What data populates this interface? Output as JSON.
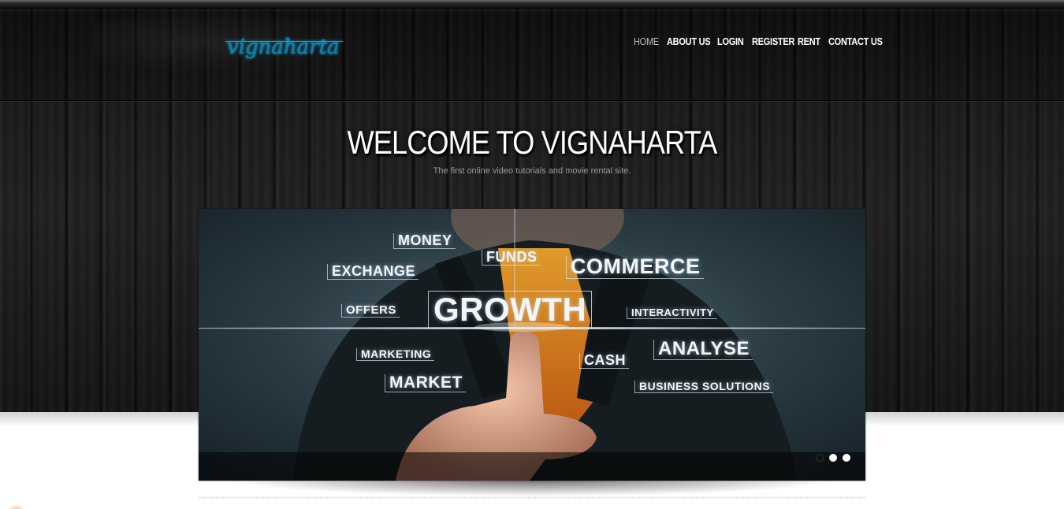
{
  "site": {
    "logo_text": "vignaharta",
    "colors": {
      "logo": "#0a7ea8",
      "nav_active": "#bdbdbd",
      "nav": "#ffffff",
      "background": "#1a1a1a"
    }
  },
  "nav": {
    "items": [
      {
        "label": "HOME",
        "active": true
      },
      {
        "label": "ABOUT US",
        "active": false
      },
      {
        "label": "LOGIN",
        "active": false
      },
      {
        "label": "REGISTER",
        "active": false
      },
      {
        "label": "RENT",
        "active": false
      },
      {
        "label": "CONTACT US",
        "active": false
      }
    ]
  },
  "hero": {
    "title": "WELCOME TO VIGNAHARTA",
    "tagline": "The first online video tutorials and movie rental site."
  },
  "slider": {
    "words": [
      "MONEY",
      "FUNDS",
      "COMMERCE",
      "EXCHANGE",
      "GROWTH",
      "OFFERS",
      "INTERACTIVITY",
      "ANALYSE",
      "MARKETING",
      "CASH",
      "MARKET",
      "BUSINESS SOLUTIONS"
    ],
    "dots_count": 3,
    "active_dot": 1
  }
}
